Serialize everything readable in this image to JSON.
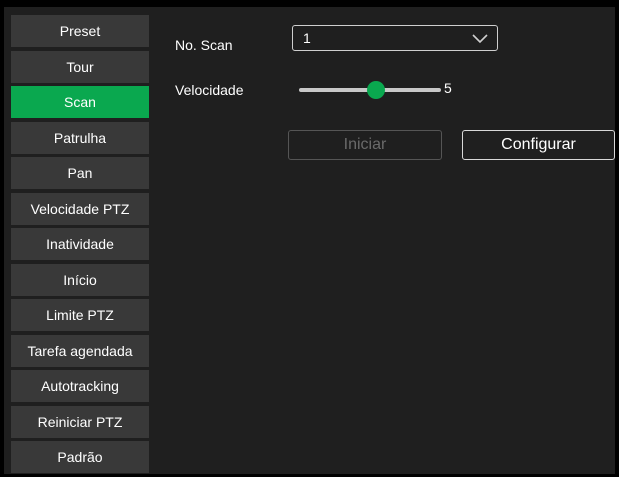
{
  "menu": {
    "items": [
      {
        "label": "Preset"
      },
      {
        "label": "Tour"
      },
      {
        "label": "Scan",
        "active": true
      },
      {
        "label": "Patrulha"
      },
      {
        "label": "Pan"
      },
      {
        "label": "Velocidade PTZ"
      },
      {
        "label": "Inatividade"
      },
      {
        "label": "Início"
      },
      {
        "label": "Limite PTZ"
      },
      {
        "label": "Tarefa agendada"
      },
      {
        "label": "Autotracking"
      },
      {
        "label": "Reiniciar PTZ"
      },
      {
        "label": "Padrão"
      }
    ]
  },
  "form": {
    "scan_no_label": "No. Scan",
    "scan_no_value": "1",
    "speed_label": "Velocidade",
    "speed_value": "5",
    "speed_fraction": 0.54,
    "start_button": "Iniciar",
    "configure_button": "Configurar"
  },
  "colors": {
    "accent": "#0aa84f",
    "panel": "#1f1f1f",
    "menu_item": "#393939"
  },
  "icons": {
    "dropdown": "chevron-down-icon"
  }
}
